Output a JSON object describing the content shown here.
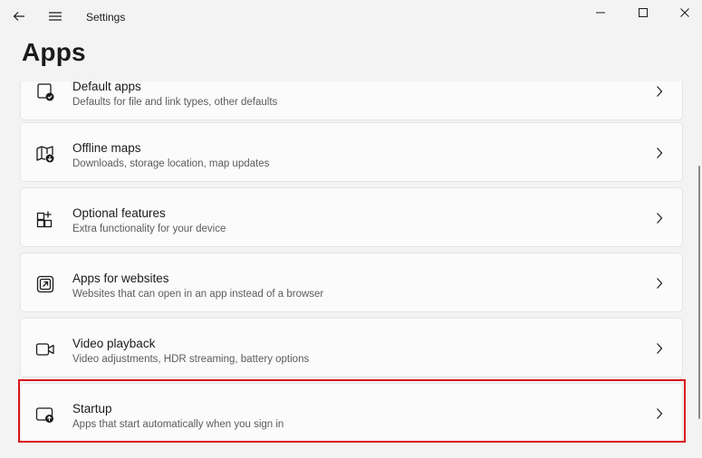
{
  "window": {
    "title": "Settings",
    "icons": {
      "back": "arrow-left-icon",
      "menu": "hamburger-icon",
      "minimize": "minimize-icon",
      "maximize": "maximize-icon",
      "close": "close-icon"
    }
  },
  "page": {
    "title": "Apps"
  },
  "items": [
    {
      "title": "Default apps",
      "desc": "Defaults for file and link types, other defaults",
      "icon": "default-apps-icon"
    },
    {
      "title": "Offline maps",
      "desc": "Downloads, storage location, map updates",
      "icon": "map-download-icon"
    },
    {
      "title": "Optional features",
      "desc": "Extra functionality for your device",
      "icon": "add-features-icon"
    },
    {
      "title": "Apps for websites",
      "desc": "Websites that can open in an app instead of a browser",
      "icon": "open-in-app-icon"
    },
    {
      "title": "Video playback",
      "desc": "Video adjustments, HDR streaming, battery options",
      "icon": "video-camera-icon"
    },
    {
      "title": "Startup",
      "desc": "Apps that start automatically when you sign in",
      "icon": "startup-icon"
    }
  ],
  "highlight": {
    "color": "#d9141c",
    "target": "Startup"
  }
}
